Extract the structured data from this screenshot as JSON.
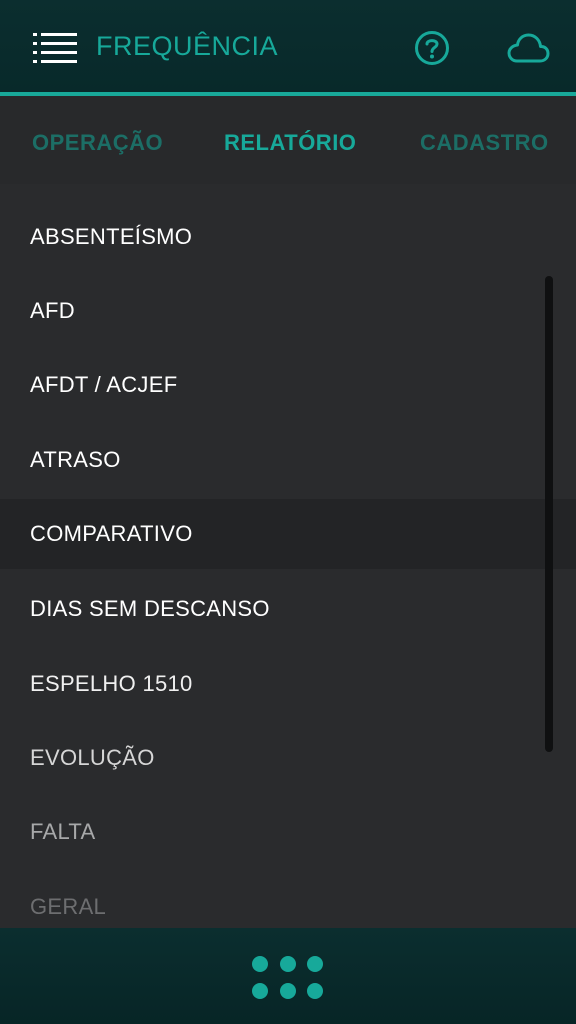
{
  "header": {
    "title": "FREQUÊNCIA",
    "icons": {
      "menu": "menu-list-icon",
      "help": "help-circle-icon",
      "cloud": "cloud-icon"
    }
  },
  "tabs": [
    {
      "label": "OPERAÇÃO",
      "active": false
    },
    {
      "label": "RELATÓRIO",
      "active": true
    },
    {
      "label": "CADASTRO",
      "active": false
    }
  ],
  "list": {
    "items": [
      {
        "label": "ABSENTEÍSMO"
      },
      {
        "label": "AFD"
      },
      {
        "label": "AFDT / ACJEF"
      },
      {
        "label": "ATRASO"
      },
      {
        "label": "COMPARATIVO",
        "selected": true
      },
      {
        "label": "DIAS SEM DESCANSO"
      },
      {
        "label": "ESPELHO 1510"
      },
      {
        "label": "EVOLUÇÃO"
      },
      {
        "label": "FALTA"
      },
      {
        "label": "GERAL"
      }
    ]
  },
  "bottom_bar": {
    "icon": "apps-grid-icon"
  },
  "colors": {
    "accent": "#17a99a",
    "accent_dim": "#1c6e66",
    "header_bg": "#0b2e2f",
    "list_bg": "#2a2b2d",
    "selected_bg": "#232426"
  }
}
